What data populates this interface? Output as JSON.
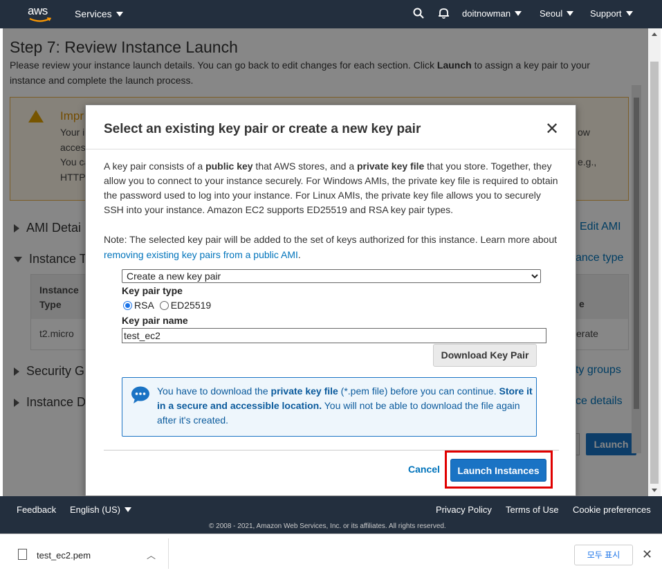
{
  "topnav": {
    "logo": "aws",
    "services": "Services",
    "account": "doitnowman",
    "region": "Seoul",
    "support": "Support"
  },
  "page": {
    "title": "Step 7: Review Instance Launch",
    "intro_pre": "Please review your instance launch details. You can go back to edit changes for each section. Click ",
    "intro_bold": "Launch",
    "intro_post": " to assign a key pair to your instance and complete the launch process.",
    "warning": {
      "title": "Impr",
      "line1": "Your i",
      "line2": "acces",
      "line3": "You ca",
      "line4": "HTTP",
      "right1": "ow",
      "right2": "e.g.,"
    },
    "sections": {
      "ami": "AMI Detai",
      "instance_type": "Instance T",
      "security": "Security G",
      "instance_details": "Instance D"
    },
    "edit_links": {
      "ami": "Edit AMI",
      "instance_type": "ance type",
      "security": "ty groups",
      "instance_details": "ce details"
    },
    "table": {
      "header": "Instance Type",
      "header_l1": "Instance",
      "header_l2": "Type",
      "cell": "t2.micro",
      "right_header": "e",
      "right_cell": "erate"
    },
    "launch_button": "Launch"
  },
  "modal": {
    "title": "Select an existing key pair or create a new key pair",
    "close": "✕",
    "p1_a": "A key pair consists of a ",
    "p1_b": "public key",
    "p1_c": " that AWS stores, and a ",
    "p1_d": "private key file",
    "p1_e": " that you store. Together, they allow you to connect to your instance securely. For Windows AMIs, the private key file is required to obtain the password used to log into your instance. For Linux AMIs, the private key file allows you to securely SSH into your instance. Amazon EC2 supports ED25519 and RSA key pair types.",
    "p2_a": "Note: The selected key pair will be added to the set of keys authorized for this instance. Learn more about ",
    "p2_link": "removing existing key pairs from a public AMI",
    "p2_b": ".",
    "select_value": "Create a new key pair",
    "key_pair_type_label": "Key pair type",
    "radio_rsa": "RSA",
    "radio_ed": "ED25519",
    "key_pair_name_label": "Key pair name",
    "key_pair_name_value": "test_ec2",
    "download_button": "Download Key Pair",
    "info_a": "You have to download the ",
    "info_b": "private key file",
    "info_c": " (*.pem file) before you can continue. ",
    "info_d": "Store it in a secure and accessible location.",
    "info_e": " You will not be able to download the file again after it's created.",
    "cancel": "Cancel",
    "launch_instances": "Launch Instances"
  },
  "footer": {
    "feedback": "Feedback",
    "language": "English (US)",
    "privacy": "Privacy Policy",
    "terms": "Terms of Use",
    "cookie": "Cookie preferences",
    "copyright": "© 2008 - 2021, Amazon Web Services, Inc. or its affiliates. All rights reserved."
  },
  "download_bar": {
    "file_name": "test_ec2.pem",
    "show_all": "모두 표시",
    "close": "✕"
  },
  "colors": {
    "nav_bg": "#232f3e",
    "primary": "#1a73c4",
    "link": "#0073bb",
    "highlight": "#e00000"
  }
}
